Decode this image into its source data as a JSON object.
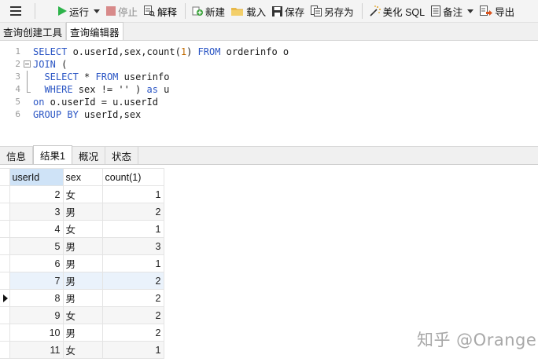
{
  "toolbar": {
    "run_label": "运行",
    "stop_label": "停止",
    "explain_label": "解释",
    "new_label": "新建",
    "load_label": "载入",
    "save_label": "保存",
    "save_as_label": "另存为",
    "beautify_label": "美化 SQL",
    "notes_label": "备注",
    "export_label": "导出"
  },
  "editor_tabs": [
    "查询创建工具",
    "查询编辑器"
  ],
  "editor": {
    "line_numbers": [
      "1",
      "2",
      "3",
      "4",
      "5",
      "6"
    ],
    "lines": [
      "SELECT o.userId,sex,count(1) FROM orderinfo o",
      "JOIN (",
      "  SELECT * FROM userinfo",
      "  WHERE sex != '' ) as u",
      "on o.userId = u.userId",
      "GROUP BY userId,sex"
    ]
  },
  "result_tabs": [
    "信息",
    "结果1",
    "概况",
    "状态"
  ],
  "grid": {
    "columns": [
      "userId",
      "sex",
      "count(1)"
    ],
    "rows": [
      [
        "2",
        "女",
        "1"
      ],
      [
        "3",
        "男",
        "2"
      ],
      [
        "4",
        "女",
        "1"
      ],
      [
        "5",
        "男",
        "3"
      ],
      [
        "6",
        "男",
        "1"
      ],
      [
        "7",
        "男",
        "2"
      ],
      [
        "8",
        "男",
        "2"
      ],
      [
        "9",
        "女",
        "2"
      ],
      [
        "10",
        "男",
        "2"
      ],
      [
        "11",
        "女",
        "1"
      ]
    ]
  },
  "watermark": "知乎 @Orange",
  "colors": {
    "keyword": "#2a55c4",
    "number": "#c06a00",
    "selected_header": "#cfe3f7"
  }
}
